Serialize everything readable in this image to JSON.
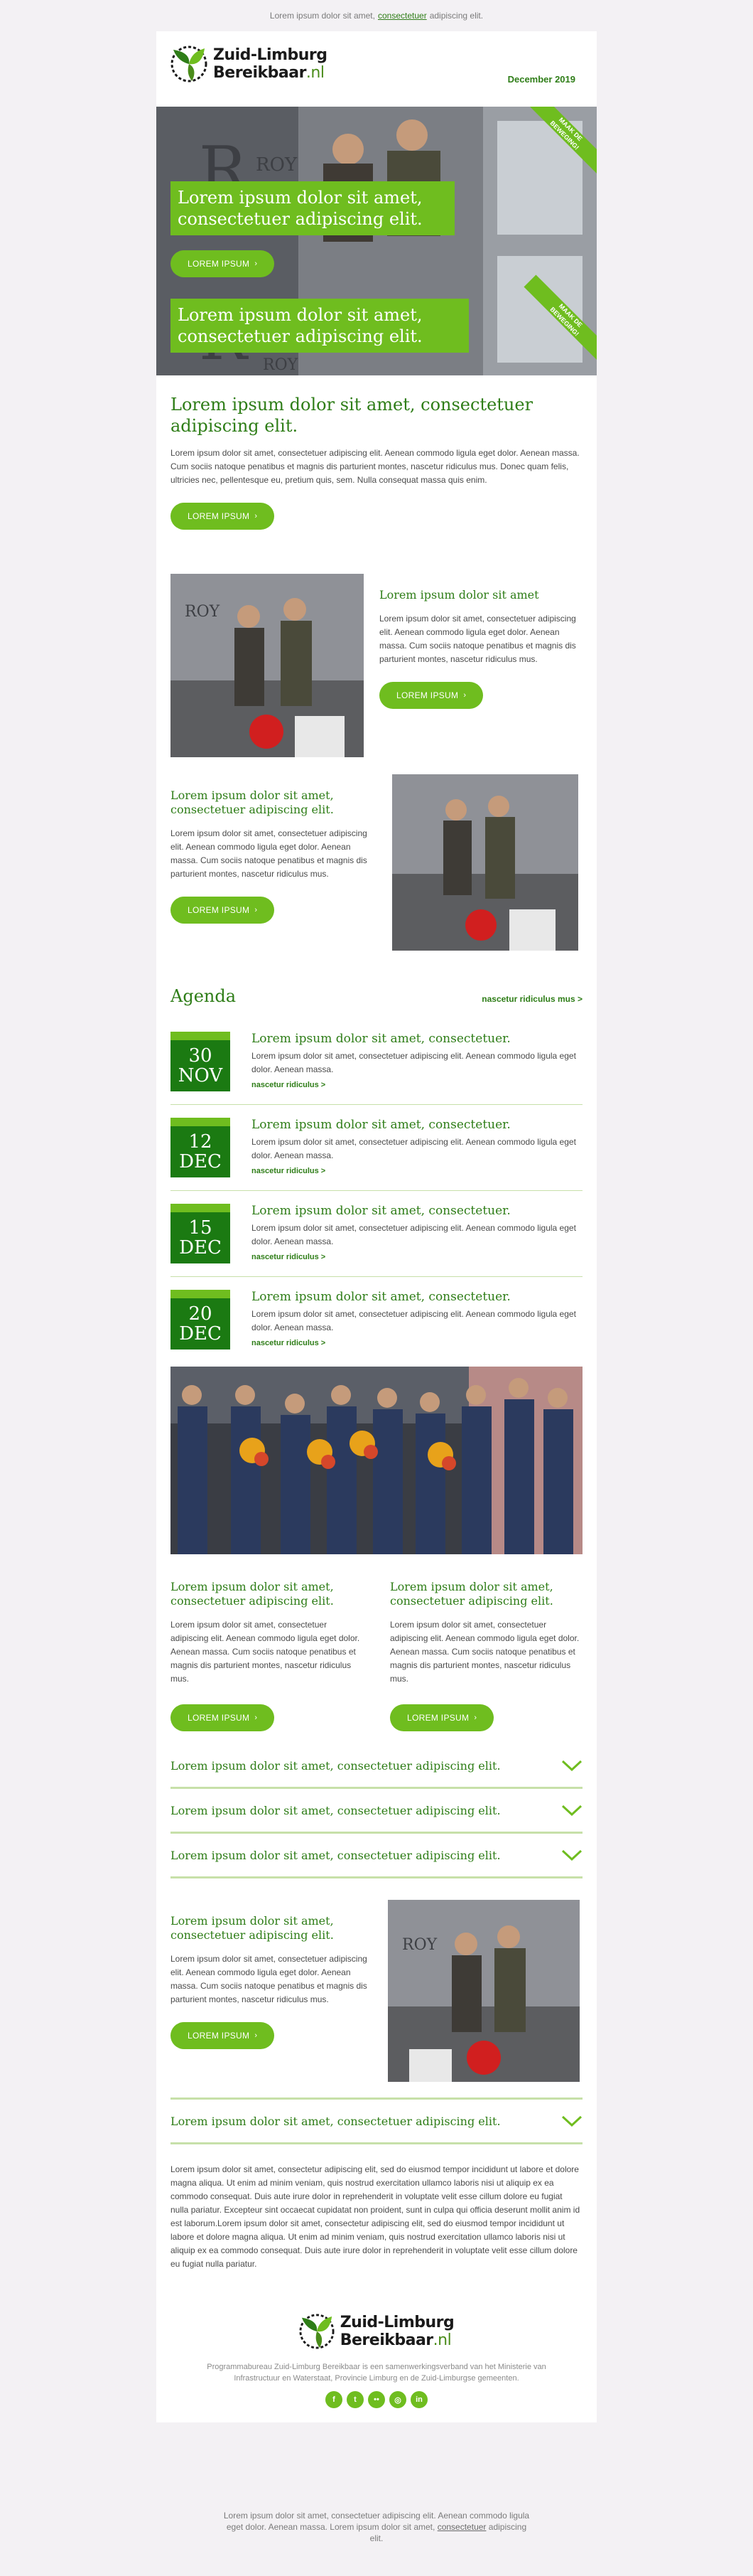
{
  "preheader": {
    "before": "Lorem ipsum dolor sit amet,",
    "link": "consectetuer",
    "after": "adipiscing elit."
  },
  "header": {
    "brand_line1": "Zuid-Limburg",
    "brand_line2": "Bereikbaar",
    "brand_suffix": ".nl",
    "date": "December 2019"
  },
  "hero": {
    "banner1": "Lorem ipsum dolor sit amet, consectetuer adipiscing elit.",
    "button": "LOREM IPSUM",
    "banner2": "Lorem ipsum dolor sit amet, consectetuer adipiscing elit.",
    "ribbon": "MAAK DE\nBEWEGING!"
  },
  "intro": {
    "title": "Lorem ipsum dolor sit amet, consectetuer adipiscing elit.",
    "text": "Lorem ipsum dolor sit amet, consectetuer adipiscing elit. Aenean commodo ligula eget dolor. Aenean massa. Cum sociis natoque penatibus et magnis dis parturient montes, nascetur ridiculus mus. Donec quam felis, ultricies nec, pellentesque eu, pretium quis, sem. Nulla consequat massa quis enim.",
    "button": "LOREM IPSUM"
  },
  "block1": {
    "title": "Lorem ipsum dolor sit amet",
    "text": "Lorem ipsum dolor sit amet, consectetuer adipiscing elit. Aenean commodo ligula eget dolor. Aenean massa. Cum sociis natoque penatibus et magnis dis parturient montes, nascetur ridiculus mus.",
    "button": "LOREM IPSUM"
  },
  "block2": {
    "title": "Lorem ipsum dolor sit amet, consectetuer adipiscing elit.",
    "text": "Lorem ipsum dolor sit amet, consectetuer adipiscing elit. Aenean commodo ligula eget dolor. Aenean massa. Cum sociis natoque penatibus et magnis dis parturient montes, nascetur ridiculus mus.",
    "button": "LOREM IPSUM"
  },
  "agenda": {
    "title": "Agenda",
    "link": "nascetur ridiculus mus >",
    "events": [
      {
        "day": "30",
        "month": "NOV",
        "title": "Lorem ipsum dolor sit amet, consectetuer.",
        "text": "Lorem ipsum dolor sit amet, consectetuer adipiscing elit. Aenean commodo ligula eget dolor. Aenean massa.",
        "more": "nascetur ridiculus >"
      },
      {
        "day": "12",
        "month": "DEC",
        "title": "Lorem ipsum dolor sit amet, consectetuer.",
        "text": "Lorem ipsum dolor sit amet, consectetuer adipiscing elit. Aenean commodo ligula eget dolor. Aenean massa.",
        "more": "nascetur ridiculus >"
      },
      {
        "day": "15",
        "month": "DEC",
        "title": "Lorem ipsum dolor sit amet, consectetuer.",
        "text": "Lorem ipsum dolor sit amet, consectetuer adipiscing elit. Aenean commodo ligula eget dolor. Aenean massa.",
        "more": "nascetur ridiculus >"
      },
      {
        "day": "20",
        "month": "DEC",
        "title": "Lorem ipsum dolor sit amet, consectetuer.",
        "text": "Lorem ipsum dolor sit amet, consectetuer adipiscing elit. Aenean commodo ligula eget dolor. Aenean massa.",
        "more": "nascetur ridiculus >"
      }
    ]
  },
  "cols": [
    {
      "title": "Lorem ipsum dolor sit amet, consectetuer adipiscing elit.",
      "text": "Lorem ipsum dolor sit amet, consectetuer adipiscing elit. Aenean commodo ligula eget dolor. Aenean massa. Cum sociis natoque penatibus et magnis dis parturient montes, nascetur ridiculus mus.",
      "button": "LOREM IPSUM"
    },
    {
      "title": "Lorem ipsum dolor sit amet, consectetuer adipiscing elit.",
      "text": "Lorem ipsum dolor sit amet, consectetuer adipiscing elit. Aenean commodo ligula eget dolor. Aenean massa. Cum sociis natoque penatibus et magnis dis parturient montes, nascetur ridiculus mus.",
      "button": "LOREM IPSUM"
    }
  ],
  "accordion": [
    "Lorem ipsum dolor sit amet, consectetuer adipiscing elit.",
    "Lorem ipsum dolor sit amet, consectetuer adipiscing elit.",
    "Lorem ipsum dolor sit amet, consectetuer adipiscing elit."
  ],
  "block3": {
    "title": "Lorem ipsum dolor sit amet, consectetuer adipiscing elit.",
    "text": "Lorem ipsum dolor sit amet, consectetuer adipiscing elit. Aenean commodo ligula eget dolor. Aenean massa. Cum sociis natoque penatibus et magnis dis parturient montes, nascetur ridiculus mus.",
    "button": "LOREM IPSUM"
  },
  "accordion_last": "Lorem ipsum dolor sit amet, consectetuer adipiscing elit.",
  "long_text": "Lorem ipsum dolor sit amet, consectetur adipiscing elit, sed do eiusmod tempor incididunt ut labore et dolore magna aliqua. Ut enim ad minim veniam, quis nostrud exercitation ullamco laboris nisi ut aliquip ex ea commodo consequat. Duis aute irure dolor in reprehenderit in voluptate velit esse cillum dolore eu fugiat nulla pariatur. Excepteur sint occaecat cupidatat non proident, sunt in culpa qui officia deserunt mollit anim id est laborum.Lorem ipsum dolor sit amet, consectetur adipiscing elit, sed do eiusmod tempor incididunt ut labore et dolore magna aliqua. Ut enim ad minim veniam, quis nostrud exercitation ullamco laboris nisi ut aliquip ex ea commodo consequat. Duis aute irure dolor in reprehenderit in voluptate velit esse cillum dolore eu fugiat nulla pariatur.",
  "footer": {
    "brand_line1": "Zuid-Limburg",
    "brand_line2": "Bereikbaar",
    "brand_suffix": ".nl",
    "text": "Programmabureau Zuid-Limburg Bereikbaar is een samenwerkingsverband van het Ministerie van Infrastructuur en Waterstaat, Provincie Limburg en de Zuid-Limburgse gemeenten.",
    "social": [
      {
        "icon": "facebook-icon",
        "glyph": "f"
      },
      {
        "icon": "twitter-icon",
        "glyph": "t"
      },
      {
        "icon": "flickr-icon",
        "glyph": "••"
      },
      {
        "icon": "instagram-icon",
        "glyph": "◎"
      },
      {
        "icon": "linkedin-icon",
        "glyph": "in"
      }
    ]
  },
  "postfooter": {
    "text": "Lorem ipsum dolor sit amet, consectetuer adipiscing elit. Aenean commodo ligula eget dolor. Aenean massa. Lorem ipsum dolor sit amet,",
    "link": "consectetuer",
    "after": "adipiscing elit."
  },
  "colors": {
    "brand_green": "#2e7d17",
    "accent_green": "#6fbd1f",
    "date_green": "#1b7a12",
    "background": "#f3f1f4"
  }
}
